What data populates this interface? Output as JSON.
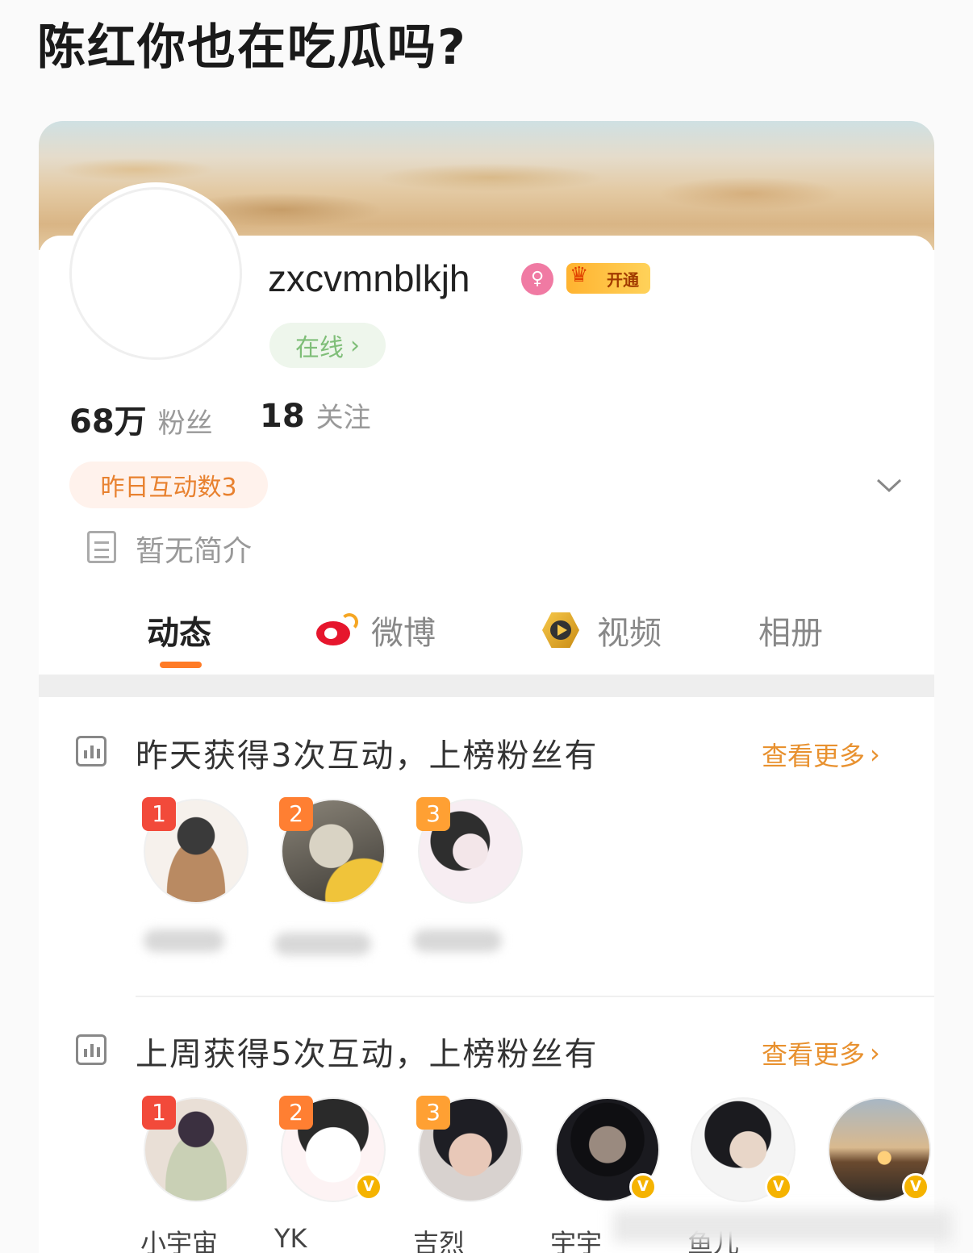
{
  "post_title": "陈红你也在吃瓜吗?",
  "profile": {
    "username": "zxcvmnblkjh",
    "gender_icon": "female-icon",
    "vip_label": "开通",
    "online_label": "在线",
    "stats": [
      {
        "value": "68万",
        "label": "粉丝"
      },
      {
        "value": "18",
        "label": "关注"
      }
    ],
    "interaction_label": "昨日互动数3",
    "bio": "暂无简介"
  },
  "tabs": [
    {
      "label": "动态",
      "active": true
    },
    {
      "label": "微博",
      "icon": "weibo-icon"
    },
    {
      "label": "视频",
      "icon": "video-icon"
    },
    {
      "label": "相册"
    }
  ],
  "sections": [
    {
      "title": "昨天获得3次互动，上榜粉丝有",
      "see_more": "查看更多",
      "fans": [
        {
          "rank": "1",
          "name": ""
        },
        {
          "rank": "2",
          "name": ""
        },
        {
          "rank": "3",
          "name": ""
        }
      ]
    },
    {
      "title": "上周获得5次互动，上榜粉丝有",
      "see_more": "查看更多",
      "fans": [
        {
          "rank": "1",
          "name": "小宇宙"
        },
        {
          "rank": "2",
          "name": "YK"
        },
        {
          "rank": "3",
          "name": "吉烈"
        },
        {
          "rank": "",
          "name": "宇宇"
        },
        {
          "rank": "",
          "name": "鱼儿"
        },
        {
          "rank": "",
          "name": ""
        }
      ]
    }
  ],
  "colors": {
    "accent_orange": "#ff7b26",
    "rank1": "#f24a3a",
    "rank2": "#ff7f32",
    "rank3": "#ffa033",
    "online_green": "#7fbe78",
    "verified_gold": "#f5b300"
  }
}
